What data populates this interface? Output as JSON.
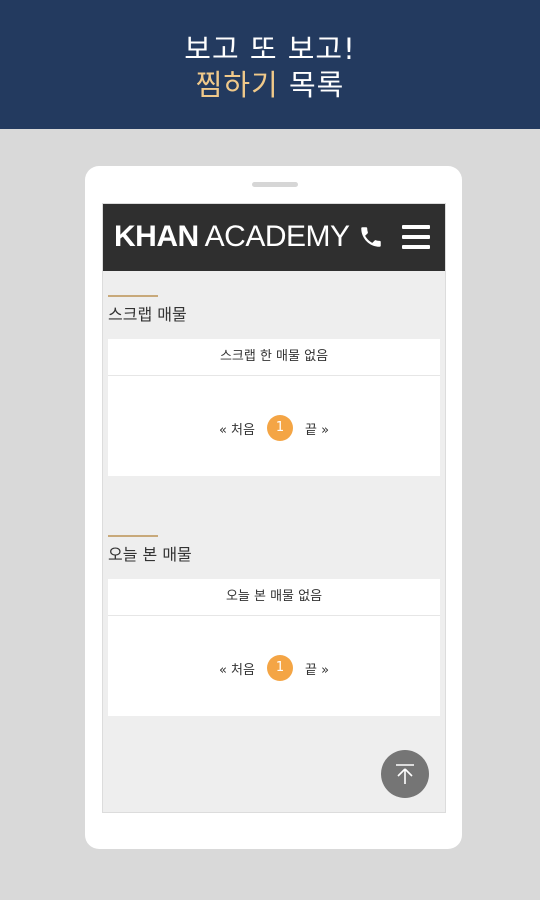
{
  "promo": {
    "line1": "보고 또 보고!",
    "line2_highlight": "찜하기",
    "line2_rest": "목록"
  },
  "app": {
    "logo_bold": "KHAN",
    "logo_thin": "ACADEMY",
    "icons": [
      "phone-icon",
      "menu-icon",
      "scroll-top-icon"
    ]
  },
  "scrap": {
    "title": "스크랩 매물",
    "empty_message": "스크랩 한 매물 없음",
    "pager": {
      "first": "« 처음",
      "current": "1",
      "last": "끝 »"
    }
  },
  "today": {
    "title": "오늘 본 매물",
    "empty_message": "오늘 본 매물 없음",
    "pager": {
      "first": "« 처음",
      "current": "1",
      "last": "끝 »"
    }
  },
  "colors": {
    "banner": "#233a5f",
    "highlight": "#f0c98a",
    "page_badge": "#f4a545",
    "header": "#2f2f2f"
  }
}
